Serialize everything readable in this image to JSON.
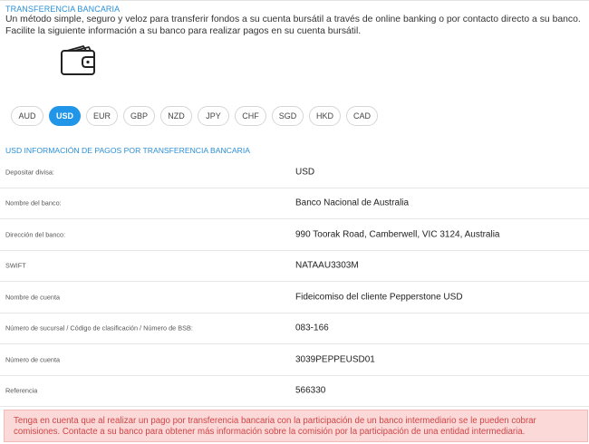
{
  "header": {
    "title": "TRANSFERENCIA BANCARIA",
    "intro_line1": "Un método simple, seguro y veloz para transferir fondos a su cuenta bursátil a través de online banking o por contacto directo a su banco.",
    "intro_line2": "Facilite la siguiente información a su banco para realizar pagos en su cuenta bursátil."
  },
  "icon": {
    "name": "wallet-icon"
  },
  "currencies": [
    {
      "label": "AUD",
      "active": false
    },
    {
      "label": "USD",
      "active": true
    },
    {
      "label": "EUR",
      "active": false
    },
    {
      "label": "GBP",
      "active": false
    },
    {
      "label": "NZD",
      "active": false
    },
    {
      "label": "JPY",
      "active": false
    },
    {
      "label": "CHF",
      "active": false
    },
    {
      "label": "SGD",
      "active": false
    },
    {
      "label": "HKD",
      "active": false
    },
    {
      "label": "CAD",
      "active": false
    }
  ],
  "info": {
    "title": "USD INFORMACIÓN DE PAGOS POR TRANSFERENCIA BANCARIA",
    "rows": [
      {
        "label": "Depositar divisa:",
        "value": "USD"
      },
      {
        "label": "Nombre del banco:",
        "value": "Banco Nacional de Australia"
      },
      {
        "label": "Dirección del banco:",
        "value": "990 Toorak Road, Camberwell, VIC 3124, Australia"
      },
      {
        "label": "SWIFT",
        "value": "NATAAU3303M"
      },
      {
        "label": "Nombre de cuenta",
        "value": "Fideicomiso del cliente Pepperstone USD"
      },
      {
        "label": "Número de sucursal / Código de clasificación / Número de BSB:",
        "value": "083-166"
      },
      {
        "label": "Número de cuenta",
        "value": "3039PEPPEUSD01"
      },
      {
        "label": "Referencia",
        "value": "566330"
      }
    ]
  },
  "notice": {
    "text": "Tenga en cuenta que al realizar un pago por transferencia bancaria con la participación de un banco intermediario se le pueden cobrar comisiones. Contacte a su banco para obtener más información sobre la comisión por la participación de una entidad intermediaria."
  },
  "colors": {
    "accent": "#2196e8",
    "heading": "#2a8fd6",
    "alert_bg": "#fbd9d9",
    "alert_text": "#d04545"
  }
}
